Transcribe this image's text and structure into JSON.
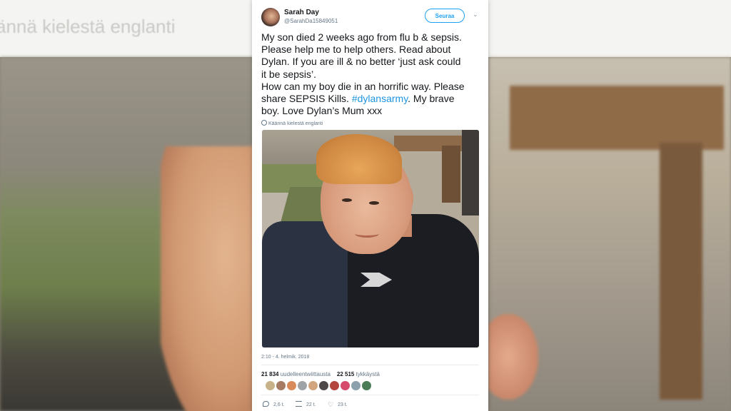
{
  "background": {
    "blurred_text": "ännä kielestä englanti"
  },
  "tweet": {
    "author_name": "Sarah Day",
    "author_handle": "@SarahDa15849051",
    "follow_label": "Seuraa",
    "text_lines": [
      "My son died 2 weeks ago from flu b & sepsis.",
      "Please help me to help others. Read about",
      "Dylan. If you are ill & no better ‘just ask could",
      "it be sepsis’.",
      "How can my boy die in an horrific way. Please",
      "share SEPSIS Kills. ",
      "#dylansarmy",
      ". My brave",
      "boy. Love Dylan’s Mum xxx"
    ],
    "translate_label": "Käännä kielestä englanti",
    "timestamp": "2:10 - 4. helmik. 2018",
    "retweets_count": "21 834",
    "retweets_label": "uudelleentwiittausta",
    "likes_count": "22 515",
    "likes_label": "tykkäystä",
    "reply_count": "2,6 t.",
    "retweet_count_short": "22 t.",
    "like_count_short": "23 t.",
    "colors": {
      "link": "#1b95e0",
      "follow": "#1da1f2",
      "muted": "#657786",
      "text": "#14171a"
    }
  }
}
